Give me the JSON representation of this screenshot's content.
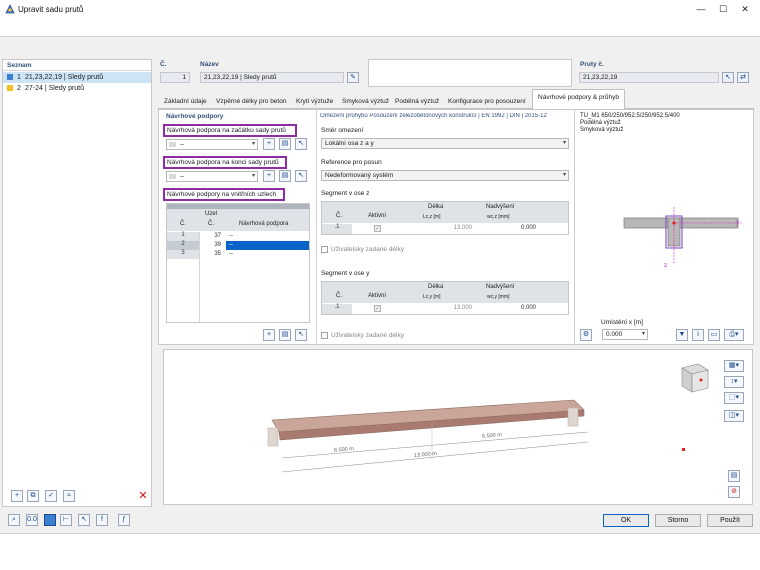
{
  "window": {
    "title": "Upravit sadu prutů",
    "minimize_glyph": "—",
    "maximize_glyph": "☐",
    "close_glyph": "✕"
  },
  "list": {
    "header": "Seznam",
    "items": [
      {
        "num": "1",
        "label": "21,23,22,19 | Sledy prutů",
        "color": "#3c7fd0"
      },
      {
        "num": "2",
        "label": "27-24 | Sledy prutů",
        "color": "#f0c020"
      }
    ]
  },
  "top": {
    "no_label": "Č.",
    "no_value": "1",
    "name_label": "Název",
    "name_value": "21,23,22,19 | Sledy prutů",
    "members_label": "Pruty č.",
    "members_value": "21,23,22,19"
  },
  "tabs": [
    "Základní údaje",
    "Vzpěrné délky pro beton",
    "Krytí výztuže",
    "Smyková výztuž",
    "Podélná výztuž",
    "Konfigurace pro posouzení",
    "Návrhové podpory & průhyb"
  ],
  "supports": {
    "section": "Návrhové podpory",
    "start_title": "Návrhová podpora na začátku sady prutů",
    "start_value": "--",
    "end_title": "Návrhová podpora na konci sady prutů",
    "end_value": "--",
    "inner_title": "Návrhové podpory na vnitřních uzlech",
    "table": {
      "h_no": "Č.",
      "h_node_top": "Uzel",
      "h_node": "Č.",
      "h_support": "Návrhová podpora",
      "rows": [
        {
          "no": "1",
          "node": "37",
          "support": "--",
          "selected": false
        },
        {
          "no": "2",
          "node": "39",
          "support": "--",
          "selected": true
        },
        {
          "no": "3",
          "node": "35",
          "support": "--",
          "selected": false
        }
      ]
    }
  },
  "deflection": {
    "header": "Omezení průhybu Posouzení železobetonových konstrukcí | EN 1992 | DIN | 2015-12",
    "direction_label": "Směr omezení",
    "direction_value": "Lokální osa z a y",
    "reference_label": "Reference pro posun",
    "reference_value": "Nedeformovaný systém",
    "seg_z_label": "Segment v ose z",
    "seg_y_label": "Segment v ose y",
    "h_no": "Č.",
    "h_active": "Aktivní",
    "h_length": "Délka",
    "h_length_z": "Lc,z [m]",
    "h_length_y": "Lc,y [m]",
    "h_camber": "Nadvýšení",
    "h_camber_z": "wc,z [mm]",
    "h_camber_y": "wc,y [mm]",
    "row_no": ".1",
    "row_len": "13.000",
    "row_camber": "0.000",
    "user_lengths": "Uživatelsky zadané délky"
  },
  "section_preview": {
    "lines": [
      "TU_M1 650/250/952.5/250/952.5/400",
      "Podélná výztuž",
      "Smyková výztuž"
    ],
    "axis_y": "y",
    "axis_z": "z",
    "position_label": "Umístění x [m]",
    "position_value": "0.000"
  },
  "model": {
    "dim_left": "6.500 m",
    "dim_right": "6.500 m",
    "dim_total": "13.000 m"
  },
  "buttons": {
    "ok": "OK",
    "cancel": "Storno",
    "apply": "Použít"
  }
}
